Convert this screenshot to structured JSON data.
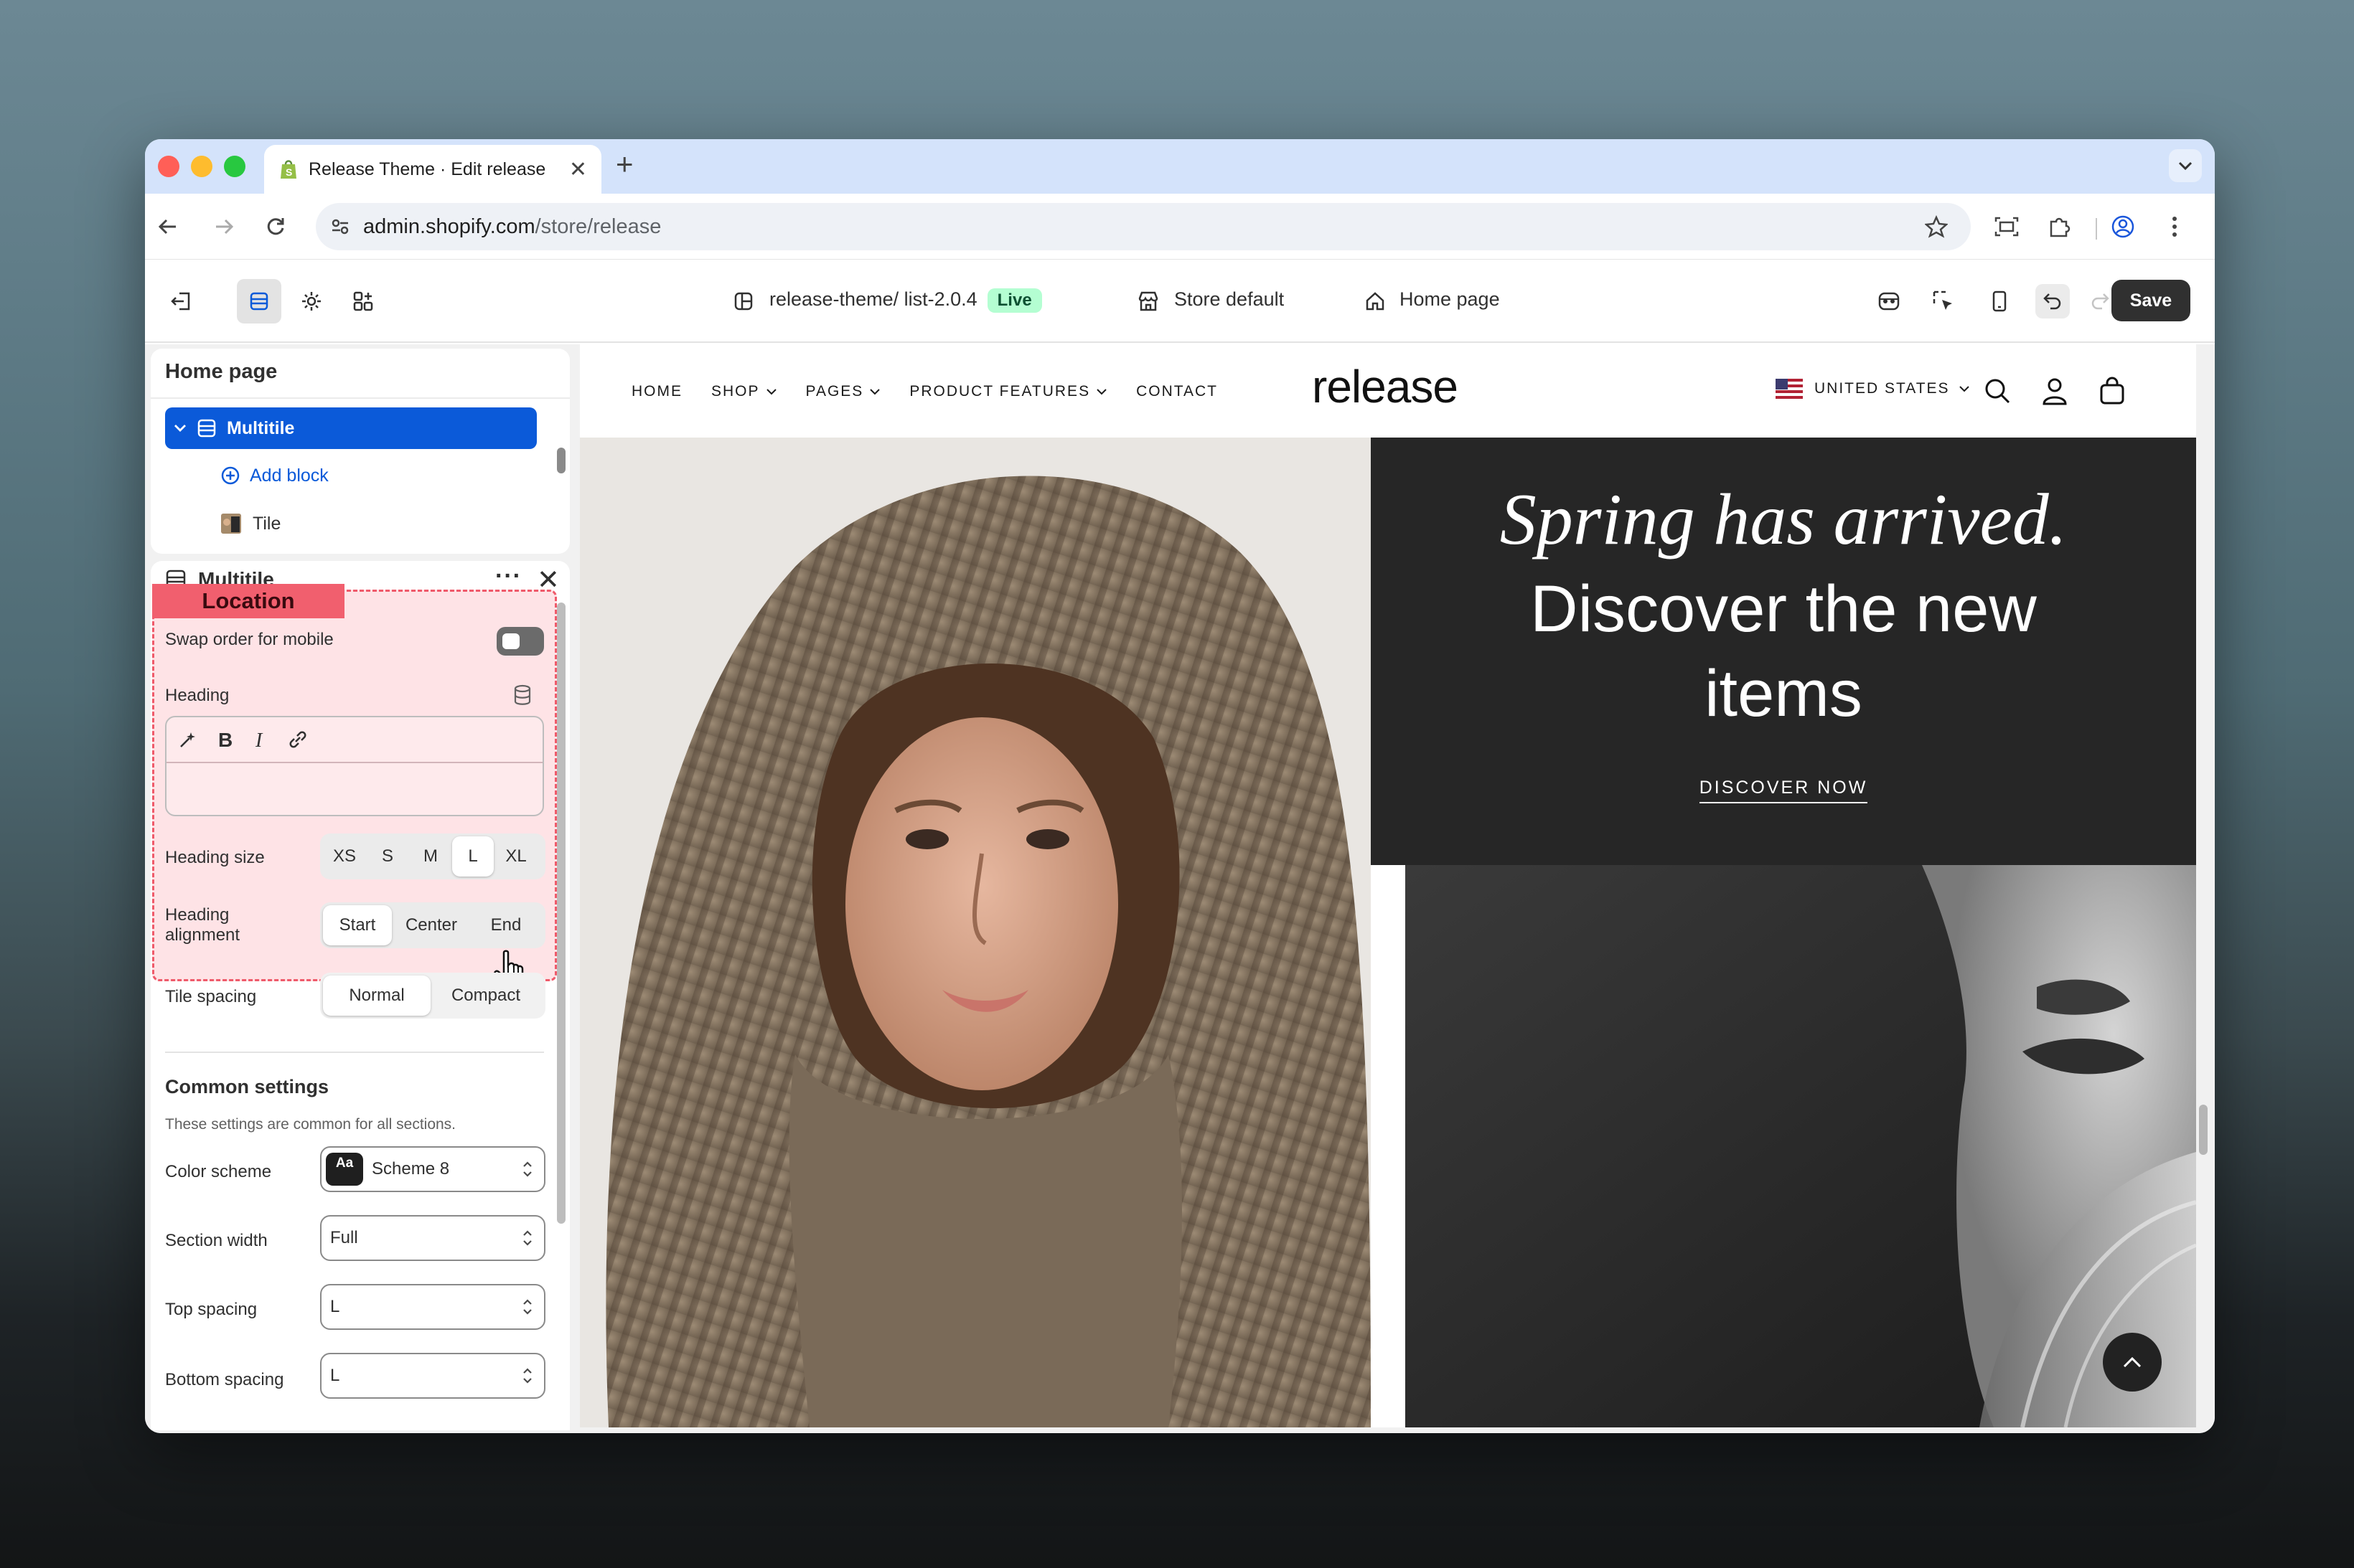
{
  "browser": {
    "tab_title": "Release Theme · Edit release",
    "url_host": "admin.shopify.com",
    "url_path": "/store/release"
  },
  "topbar": {
    "theme_name": "release-theme/ list-2.0.4",
    "live_badge": "Live",
    "store": "Store default",
    "page": "Home page",
    "save_label": "Save"
  },
  "sections_panel": {
    "title": "Home page",
    "selected_section": "Multitile",
    "add_block_label": "Add block",
    "block_label": "Tile"
  },
  "settings_panel": {
    "title": "Multitile",
    "location_tag": "Location",
    "swap_label": "Swap order for mobile",
    "heading_label": "Heading",
    "heading_size_label": "Heading size",
    "heading_sizes": [
      "XS",
      "S",
      "M",
      "L",
      "XL"
    ],
    "heading_size_selected": "L",
    "heading_alignment_label_1": "Heading",
    "heading_alignment_label_2": "alignment",
    "alignments": [
      "Start",
      "Center",
      "End"
    ],
    "alignment_selected": "Start",
    "tile_spacing_label": "Tile spacing",
    "tile_spacing_options": [
      "Normal",
      "Compact"
    ],
    "tile_spacing_selected": "Normal",
    "common_title": "Common settings",
    "common_desc": "These settings are common for all sections.",
    "color_scheme_label": "Color scheme",
    "color_scheme_badge": "Aa",
    "color_scheme_value": "Scheme 8",
    "section_width_label": "Section width",
    "section_width_value": "Full",
    "top_spacing_label": "Top spacing",
    "top_spacing_value": "L",
    "bottom_spacing_label": "Bottom spacing",
    "bottom_spacing_value": "L"
  },
  "store_preview": {
    "nav": [
      "HOME",
      "SHOP",
      "PAGES",
      "PRODUCT FEATURES",
      "CONTACT"
    ],
    "logo": "release",
    "country": "UNITED STATES",
    "hero_script": "Spring has arrived.",
    "hero_line1": "Discover the new",
    "hero_line2": "items",
    "cta": "DISCOVER NOW"
  }
}
